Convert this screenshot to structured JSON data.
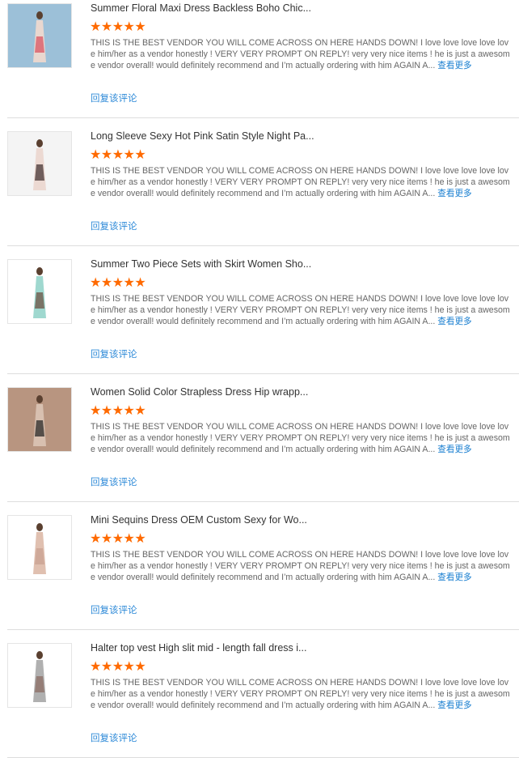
{
  "reviews": [
    {
      "title": "Summer Floral Maxi Dress Backless Boho Chic...",
      "rating": 5,
      "text": "THIS IS THE BEST VENDOR YOU WILL COME ACROSS ON HERE HANDS DOWN! I love love love love love him/her as a vendor honestly ! VERY VERY PROMPT ON REPLY! very very nice items ! he is just a awesome vendor overall! would definitely recommend and I’m actually ordering with him AGAIN A...",
      "more": "查看更多",
      "reply": "回复该评论",
      "img": [
        "#9cc0d8",
        "#e9d7cf",
        "#d94c5a"
      ]
    },
    {
      "title": "Long Sleeve Sexy Hot Pink Satin Style Night Pa...",
      "rating": 5,
      "text": "THIS IS THE BEST VENDOR YOU WILL COME ACROSS ON HERE HANDS DOWN! I love love love love love him/her as a vendor honestly ! VERY VERY PROMPT ON REPLY! very very nice items ! he is just a awesome vendor overall! would definitely recommend and I’m actually ordering with him AGAIN A...",
      "more": "查看更多",
      "reply": "回复该评论",
      "img": [
        "#f4f4f4",
        "#ecd9d2",
        "#3a2a2a"
      ]
    },
    {
      "title": "Summer Two Piece Sets with Skirt Women Sho...",
      "rating": 5,
      "text": "THIS IS THE BEST VENDOR YOU WILL COME ACROSS ON HERE HANDS DOWN! I love love love love love him/her as a vendor honestly ! VERY VERY PROMPT ON REPLY! very very nice items ! he is just a awesome vendor overall! would definitely recommend and I’m actually ordering with him AGAIN A...",
      "more": "查看更多",
      "reply": "回复该评论",
      "img": [
        "#ffffff",
        "#9fd8cf",
        "#6a4a3a"
      ]
    },
    {
      "title": "Women Solid Color Strapless Dress Hip wrapp...",
      "rating": 5,
      "text": "THIS IS THE BEST VENDOR YOU WILL COME ACROSS ON HERE HANDS DOWN! I love love love love love him/her as a vendor honestly ! VERY VERY PROMPT ON REPLY! very very nice items ! he is just a awesome vendor overall! would definitely recommend and I’m actually ordering with him AGAIN A...",
      "more": "查看更多",
      "reply": "回复该评论",
      "img": [
        "#b89580",
        "#d8c0b0",
        "#1e1e1e"
      ]
    },
    {
      "title": "Mini Sequins Dress OEM Custom Sexy for Wo...",
      "rating": 5,
      "text": "THIS IS THE BEST VENDOR YOU WILL COME ACROSS ON HERE HANDS DOWN! I love love love love love him/her as a vendor honestly ! VERY VERY PROMPT ON REPLY! very very nice items ! he is just a awesome vendor overall! would definitely recommend and I’m actually ordering with him AGAIN A...",
      "more": "查看更多",
      "reply": "回复该评论",
      "img": [
        "#ffffff",
        "#e0c0b0",
        "#c8a090"
      ]
    },
    {
      "title": "Halter top vest High slit mid - length fall dress i...",
      "rating": 5,
      "text": "THIS IS THE BEST VENDOR YOU WILL COME ACROSS ON HERE HANDS DOWN! I love love love love love him/her as a vendor honestly ! VERY VERY PROMPT ON REPLY! very very nice items ! he is just a awesome vendor overall! would definitely recommend and I’m actually ordering with him AGAIN A...",
      "more": "查看更多",
      "reply": "回复该评论",
      "img": [
        "#ffffff",
        "#b0b0b0",
        "#8a6a60"
      ]
    }
  ]
}
